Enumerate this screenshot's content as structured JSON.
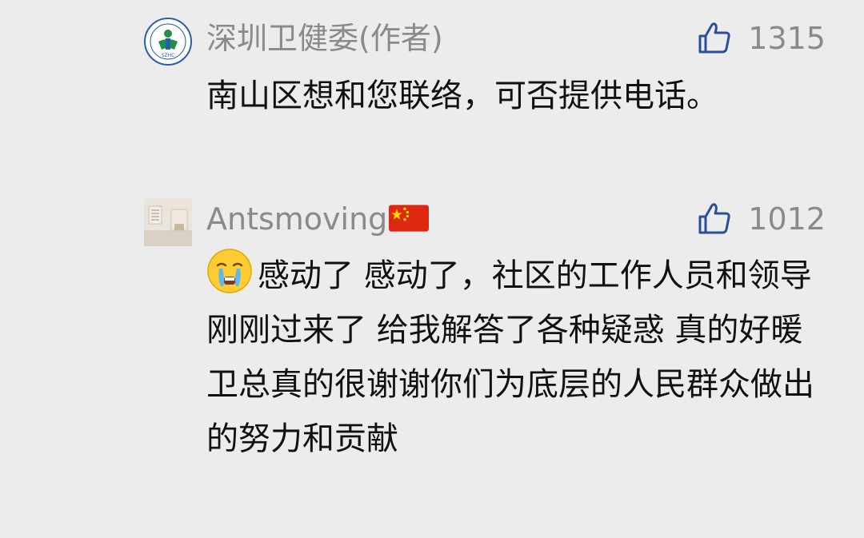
{
  "comments": [
    {
      "username": "深圳卫健委(作者)",
      "avatar": "szhc-logo-avatar",
      "avatar_text": "SZHC",
      "like_icon": "thumbs-up-icon",
      "likes": "1315",
      "text": "南山区想和您联络，可否提供电话。"
    },
    {
      "username": "Antsmoving",
      "username_badge": "china-flag-icon",
      "avatar": "interior-photo-avatar",
      "like_icon": "thumbs-up-icon",
      "likes": "1012",
      "text_emoji": "crying-face-icon",
      "text": "感动了 感动了，社区的工作人员和领导刚刚过来了 给我解答了各种疑惑 真的好暖 卫总真的很谢谢你们为底层的人民群众做出的努力和贡献"
    }
  ],
  "colors": {
    "background": "#ececec",
    "username": "#8a8a8a",
    "text": "#111111",
    "logo_green": "#1f8f4a",
    "logo_blue": "#2a5fa8"
  }
}
